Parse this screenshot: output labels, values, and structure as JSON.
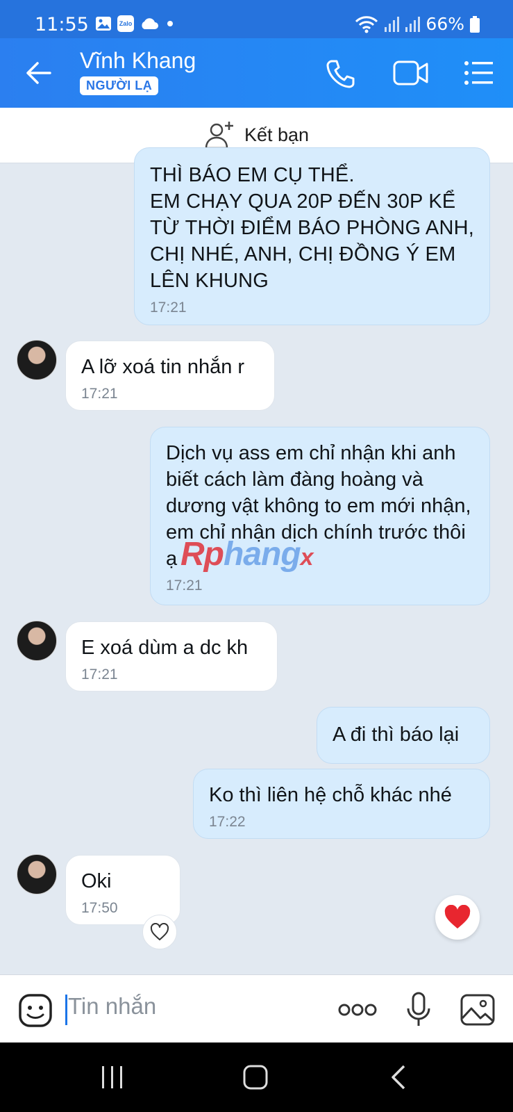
{
  "status_bar": {
    "time": "11:55",
    "battery": "66%",
    "app_badge": "Zalo"
  },
  "header": {
    "contact_name": "Vĩnh Khang",
    "tag": "NGƯỜI LẠ"
  },
  "add_friend": {
    "label": "Kết bạn"
  },
  "messages": [
    {
      "dir": "out",
      "text": "THÌ BÁO EM CỤ THỂ.\nEM CHẠY QUA 20P ĐẾN 30P KỂ TỪ THỜI ĐIỂM BÁO PHÒNG ANH, CHỊ NHÉ, ANH, CHỊ ĐỒNG Ý EM LÊN KHUNG",
      "time": "17:21"
    },
    {
      "dir": "in",
      "text": "A lỡ xoá tin nhắn r",
      "time": "17:21"
    },
    {
      "dir": "out",
      "text": "Dịch vụ ass em chỉ nhận khi anh biết cách làm đàng hoàng và dương vật không to em mới nhận, em chỉ nhận dịch chính trước thôi ạ",
      "time": "17:21"
    },
    {
      "dir": "in",
      "text": "E xoá dùm a dc kh",
      "time": "17:21"
    },
    {
      "dir": "out",
      "text": "A đi thì báo lại",
      "time": ""
    },
    {
      "dir": "out",
      "text": "Ko thì liên hệ chỗ khác nhé",
      "time": "17:22"
    },
    {
      "dir": "in",
      "text": "Oki",
      "time": "17:50"
    }
  ],
  "watermark": {
    "part1": "Rp",
    "part2": "hang",
    "part3": "x"
  },
  "input": {
    "placeholder": "Tin nhắn"
  },
  "colors": {
    "header_blue": "#2b7ff0",
    "outgoing_bubble": "#d7ecfd",
    "incoming_bubble": "#ffffff",
    "chat_background": "#e2e9f1",
    "heart_red": "#e8262f"
  }
}
